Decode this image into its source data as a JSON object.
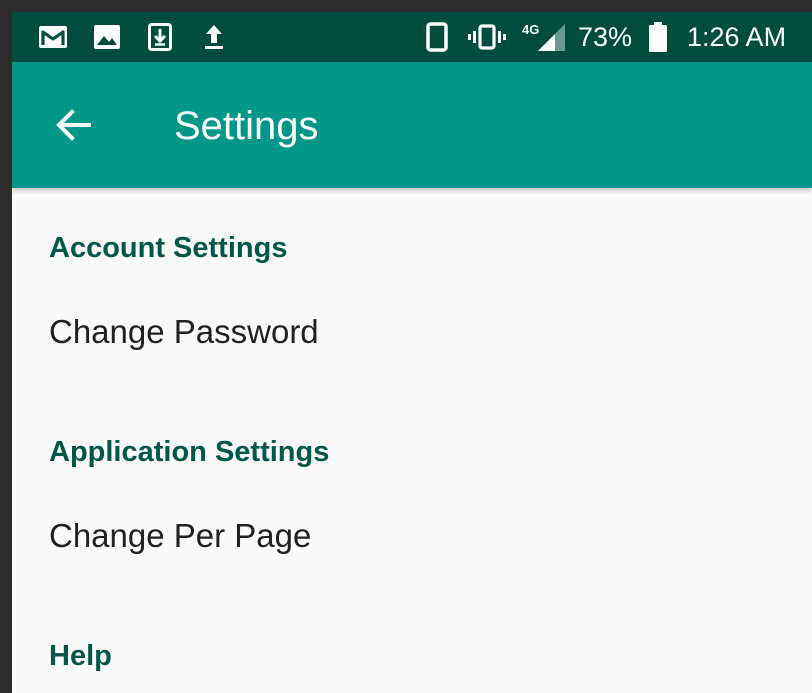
{
  "status_bar": {
    "icons_left": [
      "gmail-icon",
      "image-icon",
      "download-icon",
      "upload-icon"
    ],
    "icons_right": [
      "phone-icon",
      "vibrate-icon",
      "signal-4g-icon",
      "battery-icon"
    ],
    "network_label": "4G",
    "battery_percent": "73%",
    "time": "1:26 AM"
  },
  "app_bar": {
    "title": "Settings",
    "back_icon": "arrow-back-icon"
  },
  "sections": [
    {
      "header": "Account Settings",
      "items": [
        "Change Password"
      ]
    },
    {
      "header": "Application Settings",
      "items": [
        "Change Per Page"
      ]
    },
    {
      "header": "Help",
      "items": []
    }
  ],
  "colors": {
    "status_bar": "#004d40",
    "app_bar": "#009688",
    "section_header": "#00574b",
    "background": "#fafafa",
    "item_text": "#212121"
  }
}
